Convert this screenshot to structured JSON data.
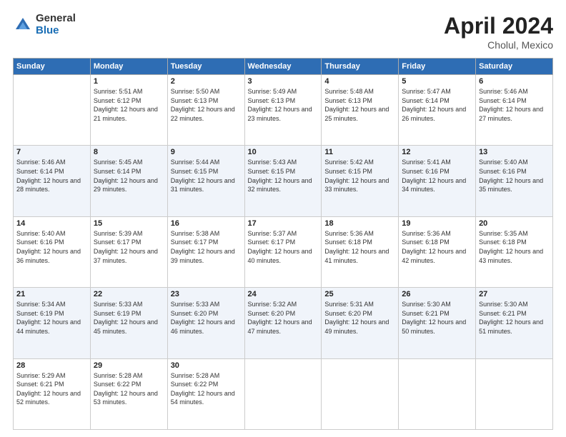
{
  "logo": {
    "general": "General",
    "blue": "Blue"
  },
  "title": {
    "month": "April 2024",
    "location": "Cholul, Mexico"
  },
  "headers": [
    "Sunday",
    "Monday",
    "Tuesday",
    "Wednesday",
    "Thursday",
    "Friday",
    "Saturday"
  ],
  "weeks": [
    {
      "rowClass": "week-row",
      "days": [
        {
          "num": "",
          "info": "",
          "empty": true
        },
        {
          "num": "1",
          "info": "Sunrise: 5:51 AM\nSunset: 6:12 PM\nDaylight: 12 hours\nand 21 minutes."
        },
        {
          "num": "2",
          "info": "Sunrise: 5:50 AM\nSunset: 6:13 PM\nDaylight: 12 hours\nand 22 minutes."
        },
        {
          "num": "3",
          "info": "Sunrise: 5:49 AM\nSunset: 6:13 PM\nDaylight: 12 hours\nand 23 minutes."
        },
        {
          "num": "4",
          "info": "Sunrise: 5:48 AM\nSunset: 6:13 PM\nDaylight: 12 hours\nand 25 minutes."
        },
        {
          "num": "5",
          "info": "Sunrise: 5:47 AM\nSunset: 6:14 PM\nDaylight: 12 hours\nand 26 minutes."
        },
        {
          "num": "6",
          "info": "Sunrise: 5:46 AM\nSunset: 6:14 PM\nDaylight: 12 hours\nand 27 minutes."
        }
      ]
    },
    {
      "rowClass": "alt-row",
      "days": [
        {
          "num": "7",
          "info": "Sunrise: 5:46 AM\nSunset: 6:14 PM\nDaylight: 12 hours\nand 28 minutes."
        },
        {
          "num": "8",
          "info": "Sunrise: 5:45 AM\nSunset: 6:14 PM\nDaylight: 12 hours\nand 29 minutes."
        },
        {
          "num": "9",
          "info": "Sunrise: 5:44 AM\nSunset: 6:15 PM\nDaylight: 12 hours\nand 31 minutes."
        },
        {
          "num": "10",
          "info": "Sunrise: 5:43 AM\nSunset: 6:15 PM\nDaylight: 12 hours\nand 32 minutes."
        },
        {
          "num": "11",
          "info": "Sunrise: 5:42 AM\nSunset: 6:15 PM\nDaylight: 12 hours\nand 33 minutes."
        },
        {
          "num": "12",
          "info": "Sunrise: 5:41 AM\nSunset: 6:16 PM\nDaylight: 12 hours\nand 34 minutes."
        },
        {
          "num": "13",
          "info": "Sunrise: 5:40 AM\nSunset: 6:16 PM\nDaylight: 12 hours\nand 35 minutes."
        }
      ]
    },
    {
      "rowClass": "week-row",
      "days": [
        {
          "num": "14",
          "info": "Sunrise: 5:40 AM\nSunset: 6:16 PM\nDaylight: 12 hours\nand 36 minutes."
        },
        {
          "num": "15",
          "info": "Sunrise: 5:39 AM\nSunset: 6:17 PM\nDaylight: 12 hours\nand 37 minutes."
        },
        {
          "num": "16",
          "info": "Sunrise: 5:38 AM\nSunset: 6:17 PM\nDaylight: 12 hours\nand 39 minutes."
        },
        {
          "num": "17",
          "info": "Sunrise: 5:37 AM\nSunset: 6:17 PM\nDaylight: 12 hours\nand 40 minutes."
        },
        {
          "num": "18",
          "info": "Sunrise: 5:36 AM\nSunset: 6:18 PM\nDaylight: 12 hours\nand 41 minutes."
        },
        {
          "num": "19",
          "info": "Sunrise: 5:36 AM\nSunset: 6:18 PM\nDaylight: 12 hours\nand 42 minutes."
        },
        {
          "num": "20",
          "info": "Sunrise: 5:35 AM\nSunset: 6:18 PM\nDaylight: 12 hours\nand 43 minutes."
        }
      ]
    },
    {
      "rowClass": "alt-row",
      "days": [
        {
          "num": "21",
          "info": "Sunrise: 5:34 AM\nSunset: 6:19 PM\nDaylight: 12 hours\nand 44 minutes."
        },
        {
          "num": "22",
          "info": "Sunrise: 5:33 AM\nSunset: 6:19 PM\nDaylight: 12 hours\nand 45 minutes."
        },
        {
          "num": "23",
          "info": "Sunrise: 5:33 AM\nSunset: 6:20 PM\nDaylight: 12 hours\nand 46 minutes."
        },
        {
          "num": "24",
          "info": "Sunrise: 5:32 AM\nSunset: 6:20 PM\nDaylight: 12 hours\nand 47 minutes."
        },
        {
          "num": "25",
          "info": "Sunrise: 5:31 AM\nSunset: 6:20 PM\nDaylight: 12 hours\nand 49 minutes."
        },
        {
          "num": "26",
          "info": "Sunrise: 5:30 AM\nSunset: 6:21 PM\nDaylight: 12 hours\nand 50 minutes."
        },
        {
          "num": "27",
          "info": "Sunrise: 5:30 AM\nSunset: 6:21 PM\nDaylight: 12 hours\nand 51 minutes."
        }
      ]
    },
    {
      "rowClass": "week-row",
      "days": [
        {
          "num": "28",
          "info": "Sunrise: 5:29 AM\nSunset: 6:21 PM\nDaylight: 12 hours\nand 52 minutes."
        },
        {
          "num": "29",
          "info": "Sunrise: 5:28 AM\nSunset: 6:22 PM\nDaylight: 12 hours\nand 53 minutes."
        },
        {
          "num": "30",
          "info": "Sunrise: 5:28 AM\nSunset: 6:22 PM\nDaylight: 12 hours\nand 54 minutes."
        },
        {
          "num": "",
          "info": "",
          "empty": true
        },
        {
          "num": "",
          "info": "",
          "empty": true
        },
        {
          "num": "",
          "info": "",
          "empty": true
        },
        {
          "num": "",
          "info": "",
          "empty": true
        }
      ]
    }
  ]
}
